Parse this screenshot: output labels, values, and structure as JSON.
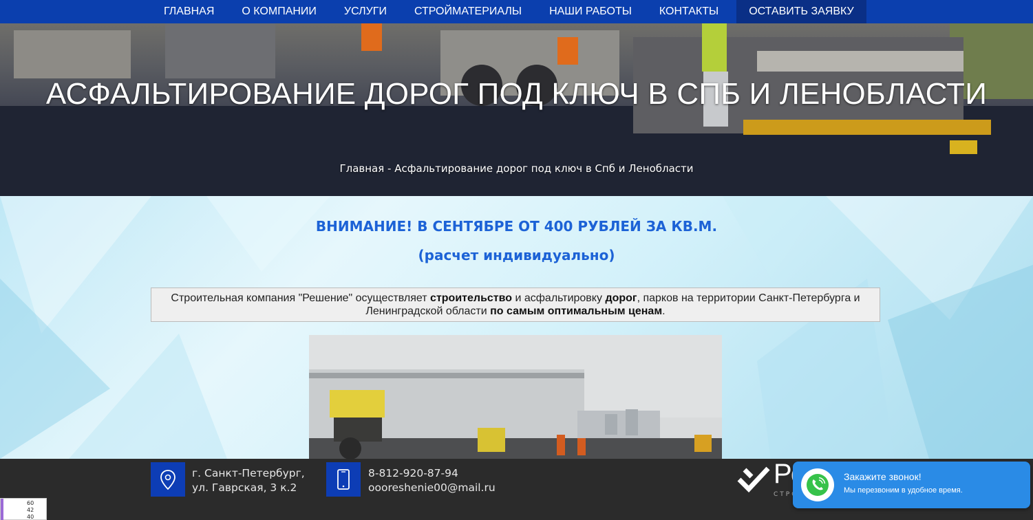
{
  "nav": {
    "items": [
      "ГЛАВНАЯ",
      "О КОМПАНИИ",
      "УСЛУГИ",
      "СТРОЙМАТЕРИАЛЫ",
      "НАШИ РАБОТЫ",
      "КОНТАКТЫ"
    ],
    "cta": "ОСТАВИТЬ ЗАЯВКУ"
  },
  "hero": {
    "title": "АСФАЛЬТИРОВАНИЕ ДОРОГ ПОД КЛЮЧ В СПБ И ЛЕНОБЛАСТИ",
    "breadcrumb": "Главная - Асфальтирование дорог под ключ в Спб и Ленобласти"
  },
  "main": {
    "attention": "ВНИМАНИЕ! В СЕНТЯБРЕ ОТ 400 РУБЛЕЙ ЗА КВ.М.",
    "calc": "(расчет индивидуально)",
    "intro": {
      "p1": "Строительная компания \"Решение\" осуществляет ",
      "b1": "строительство",
      "p2": " и асфальтировку ",
      "b2": "дорог",
      "p3": ", парков на территории Санкт-Петербурга и Ленинградской области ",
      "b3": "по самым оптимальным ценам",
      "p4": "."
    }
  },
  "footer": {
    "address_line1": "г. Санкт-Петербург,",
    "address_line2": "ул. Гаврская, 3 к.2",
    "phone": "8-812-920-87-94",
    "email": "oooreshenie00@mail.ru",
    "logo_text": "Ре",
    "logo_sub": "СТРОИ"
  },
  "callback": {
    "title": "Закажите звонок!",
    "subtitle": "Мы перезвоним в удобное время."
  },
  "counter": {
    "v1": "60",
    "v2": "42",
    "v3": "40"
  },
  "colors": {
    "nav_bg": "#0b3fae",
    "accent_blue": "#1c62d6",
    "footer_bg": "#2b2b2b",
    "callback_bg": "#2a8be6"
  }
}
